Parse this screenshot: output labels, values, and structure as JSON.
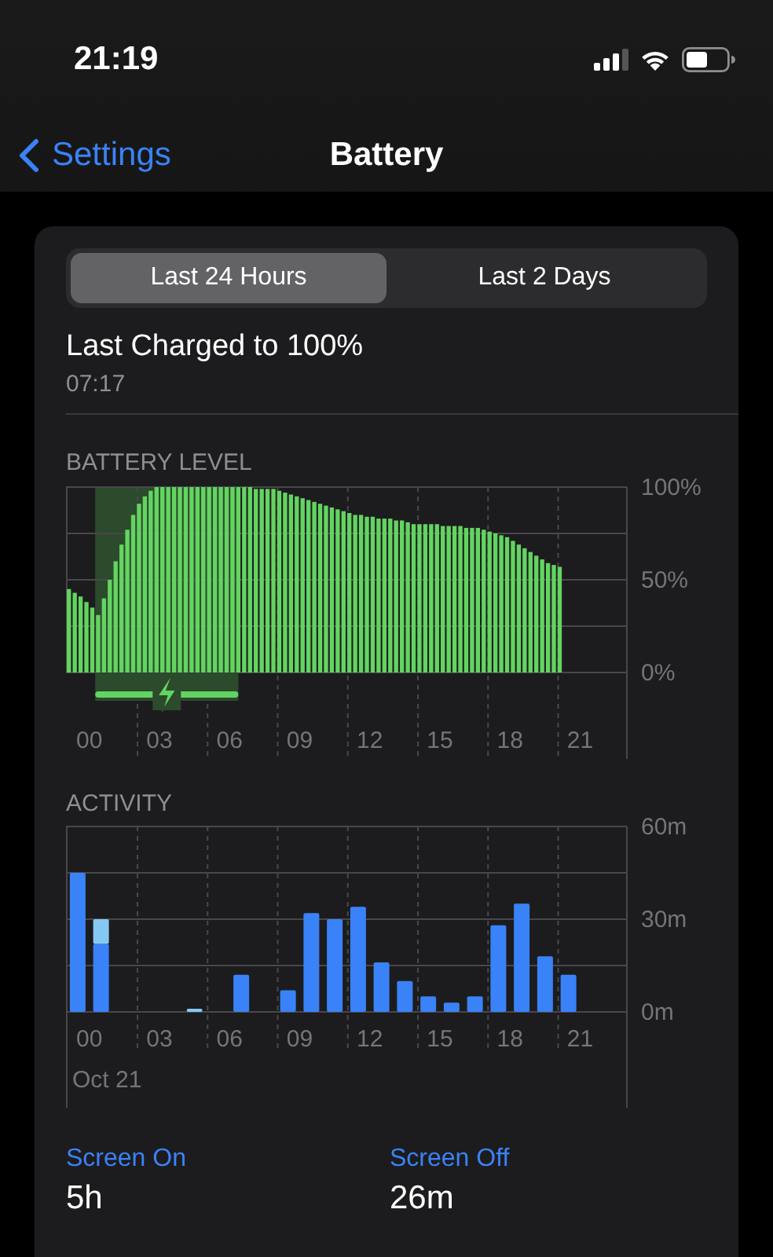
{
  "status_bar": {
    "time": "21:19"
  },
  "nav": {
    "back": "Settings",
    "title": "Battery"
  },
  "tabs": [
    {
      "label": "Last 24 Hours",
      "selected": true
    },
    {
      "label": "Last 2 Days",
      "selected": false
    }
  ],
  "last_charged": {
    "title": "Last Charged to 100%",
    "time": "07:17"
  },
  "battery_level": {
    "title": "BATTERY LEVEL",
    "chart_data": {
      "type": "bar",
      "xlim": [
        -1,
        23
      ],
      "ylim": [
        0,
        100
      ],
      "x": [
        -0.875,
        -0.625,
        -0.375,
        -0.125,
        0.125,
        0.375,
        0.625,
        0.875,
        1.125,
        1.375,
        1.625,
        1.875,
        2.125,
        2.375,
        2.625,
        2.875,
        3.125,
        3.375,
        3.625,
        3.875,
        4.125,
        4.375,
        4.625,
        4.875,
        5.125,
        5.375,
        5.625,
        5.875,
        6.125,
        6.375,
        6.625,
        6.875,
        7.125,
        7.375,
        7.625,
        7.875,
        8.125,
        8.375,
        8.625,
        8.875,
        9.125,
        9.375,
        9.625,
        9.875,
        10.125,
        10.375,
        10.625,
        10.875,
        11.125,
        11.375,
        11.625,
        11.875,
        12.125,
        12.375,
        12.625,
        12.875,
        13.125,
        13.375,
        13.625,
        13.875,
        14.125,
        14.375,
        14.625,
        14.875,
        15.125,
        15.375,
        15.625,
        15.875,
        16.125,
        16.375,
        16.625,
        16.875,
        17.125,
        17.375,
        17.625,
        17.875,
        18.125,
        18.375,
        18.625,
        18.875,
        19.125,
        19.375,
        19.625,
        19.875,
        20.125
      ],
      "series": [
        {
          "color": "#63d461",
          "values": [
            45,
            43,
            41,
            38,
            35,
            31,
            40,
            50,
            60,
            69,
            77,
            85,
            91,
            95,
            98,
            100,
            100,
            100,
            100,
            100,
            100,
            100,
            100,
            100,
            100,
            100,
            100,
            100,
            100,
            100,
            100,
            100,
            99,
            99,
            99,
            99,
            98,
            97,
            96,
            95,
            94,
            93,
            92,
            91,
            90,
            89,
            88,
            87,
            86,
            85,
            85,
            84,
            84,
            83,
            83,
            83,
            82,
            82,
            81,
            80,
            80,
            80,
            80,
            80,
            79,
            79,
            79,
            79,
            78,
            78,
            78,
            77,
            76,
            75,
            74,
            73,
            71,
            69,
            67,
            65,
            63,
            61,
            59,
            58,
            57
          ]
        }
      ],
      "xticks": [
        {
          "value": 0,
          "label": "00"
        },
        {
          "value": 3,
          "label": "03"
        },
        {
          "value": 6,
          "label": "06"
        },
        {
          "value": 9,
          "label": "09"
        },
        {
          "value": 12,
          "label": "12"
        },
        {
          "value": 15,
          "label": "15"
        },
        {
          "value": 18,
          "label": "18"
        },
        {
          "value": 21,
          "label": "21"
        }
      ],
      "yticks": [
        {
          "value": 0,
          "label": "0%"
        },
        {
          "value": 50,
          "label": "50%"
        },
        {
          "value": 100,
          "label": "100%"
        }
      ]
    }
  },
  "activity": {
    "title": "ACTIVITY",
    "date": "Oct 21",
    "chart_data": {
      "type": "bar",
      "stacked": true,
      "xlim": [
        -1,
        23
      ],
      "ylim": [
        0,
        60
      ],
      "x": [
        -0.5,
        0.5,
        4.5,
        6.5,
        8.5,
        9.5,
        10.5,
        11.5,
        12.5,
        13.5,
        14.5,
        15.5,
        16.5,
        17.5,
        18.5,
        19.5,
        20.5
      ],
      "series": [
        {
          "color": "#3a82f7",
          "values": [
            45,
            22,
            0,
            12,
            7,
            32,
            30,
            34,
            16,
            10,
            5,
            3,
            5,
            28,
            35,
            18,
            12
          ]
        },
        {
          "color": "#86c8f4",
          "values": [
            0,
            8,
            1,
            0,
            0,
            0,
            0,
            0,
            0,
            0,
            0,
            0,
            0,
            0,
            0,
            0,
            0
          ]
        }
      ],
      "xticks": [
        {
          "value": 0,
          "label": "00"
        },
        {
          "value": 3,
          "label": "03"
        },
        {
          "value": 6,
          "label": "06"
        },
        {
          "value": 9,
          "label": "09"
        },
        {
          "value": 12,
          "label": "12"
        },
        {
          "value": 15,
          "label": "15"
        },
        {
          "value": 18,
          "label": "18"
        },
        {
          "value": 21,
          "label": "21"
        }
      ],
      "yticks": [
        {
          "value": 0,
          "label": "0m"
        },
        {
          "value": 30,
          "label": "30m"
        },
        {
          "value": 60,
          "label": "60m"
        }
      ]
    }
  },
  "screen_stats": [
    {
      "label": "Screen On",
      "value": "5h"
    },
    {
      "label": "Screen Off",
      "value": "26m"
    }
  ]
}
